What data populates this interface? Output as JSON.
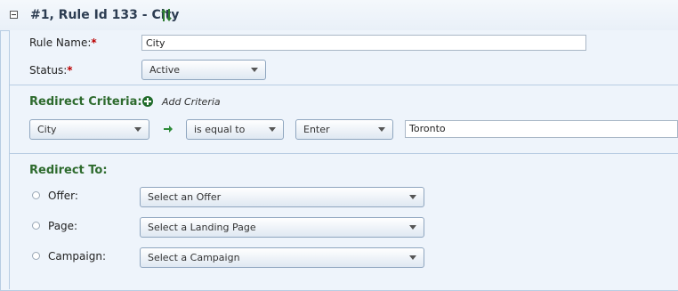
{
  "header": {
    "title": "#1, Rule Id 133 - City",
    "collapse_icon": "collapse-minus-icon",
    "sort_icon": "sort-arrows-icon"
  },
  "rule_name": {
    "label": "Rule Name:",
    "required": "*",
    "value": "City"
  },
  "status": {
    "label": "Status:",
    "required": "*",
    "value": "Active"
  },
  "redirect_criteria": {
    "title": "Redirect Criteria:",
    "add_label": "Add Criteria",
    "field": "City",
    "operator": "is equal to",
    "mode": "Enter",
    "value": "Toronto"
  },
  "redirect_to": {
    "title": "Redirect To:",
    "options": [
      {
        "label": "Offer:",
        "select": "Select an Offer"
      },
      {
        "label": "Page:",
        "select": "Select a Landing Page"
      },
      {
        "label": "Campaign:",
        "select": "Select a Campaign"
      }
    ]
  },
  "colors": {
    "section_title": "#2e6b2e",
    "header_text": "#2d3d52",
    "required": "#b00000",
    "background": "#eef4fb"
  }
}
